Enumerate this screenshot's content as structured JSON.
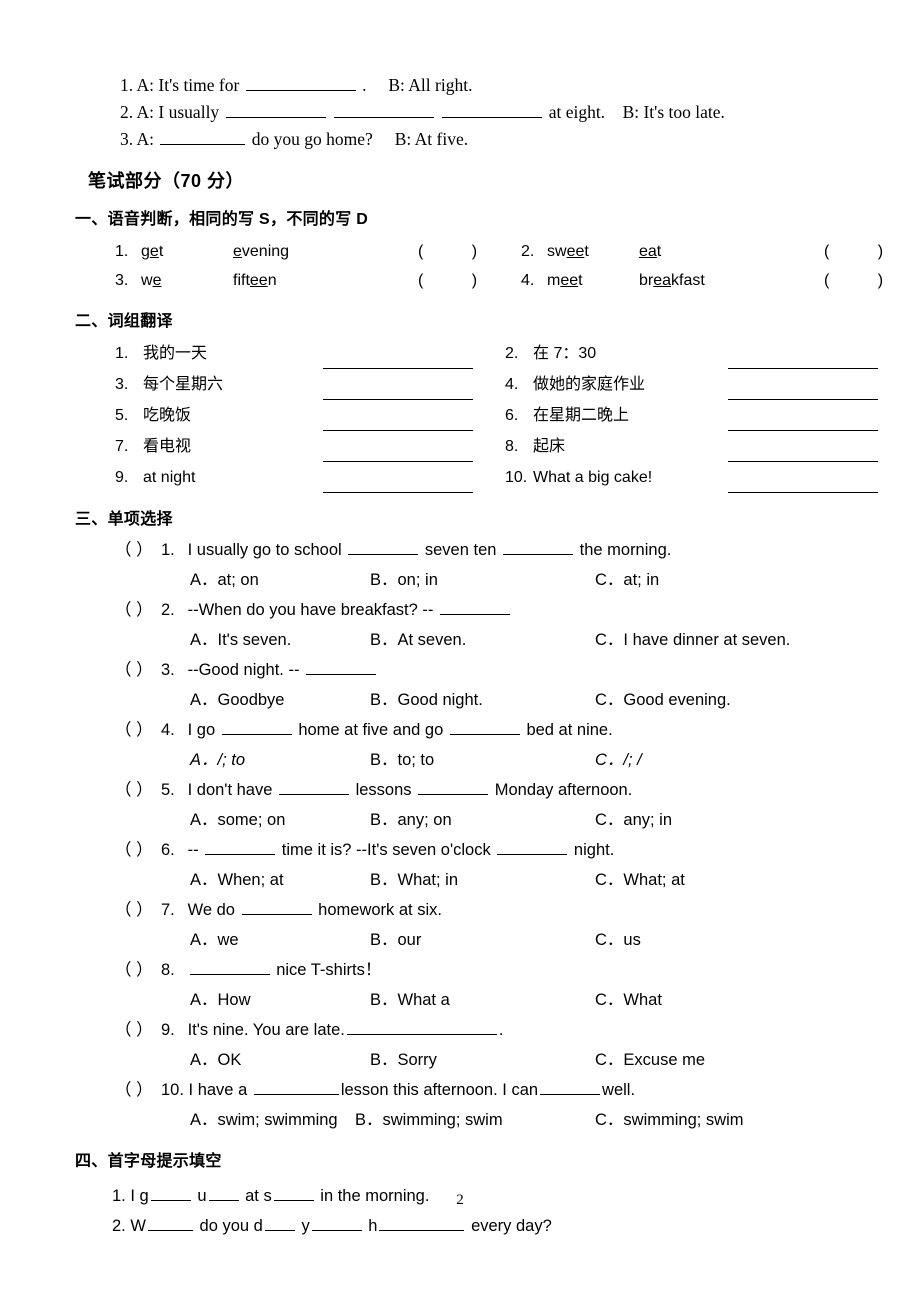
{
  "page": {
    "number": "2"
  },
  "listening_tail": {
    "items": [
      {
        "num": "1.",
        "speaker_a": "A: It's time for",
        "after_blank": ".",
        "speaker_b": "B: All right."
      },
      {
        "num": "2.",
        "speaker_a": "A: I usually",
        "after_blank": "at eight.",
        "speaker_b": "B: It's too late."
      },
      {
        "num": "3.",
        "speaker_a": "A:",
        "after_blank": "do you go home?",
        "speaker_b": "B: At five."
      }
    ]
  },
  "part_title": "笔试部分（70 分）",
  "section1": {
    "heading": "一、语音判断，相同的写 S，不同的写 D",
    "rows": [
      [
        {
          "num": "1.",
          "word1_pre": "g",
          "word1_ul": "e",
          "word1_post": "t",
          "word2_pre": "",
          "word2_ul": "e",
          "word2_post": "vening",
          "paren": "(      )"
        },
        {
          "num": "2.",
          "word1_pre": "sw",
          "word1_ul": "ee",
          "word1_post": "t",
          "word2_pre": "",
          "word2_ul": "ea",
          "word2_post": "t",
          "paren": "(      )"
        }
      ],
      [
        {
          "num": "3.",
          "word1_pre": "w",
          "word1_ul": "e",
          "word1_post": "",
          "word2_pre": "fift",
          "word2_ul": "ee",
          "word2_post": "n",
          "paren": "(      )"
        },
        {
          "num": "4.",
          "word1_pre": "m",
          "word1_ul": "ee",
          "word1_post": "t",
          "word2_pre": "br",
          "word2_ul": "ea",
          "word2_post": "kfast",
          "paren": "(      )"
        }
      ]
    ]
  },
  "section2": {
    "heading": "二、词组翻译",
    "rows": [
      [
        {
          "num": "1.",
          "text": "我的一天"
        },
        {
          "num": "2.",
          "text": "在 7：30"
        }
      ],
      [
        {
          "num": "3.",
          "text": "每个星期六"
        },
        {
          "num": "4.",
          "text": "做她的家庭作业"
        }
      ],
      [
        {
          "num": "5.",
          "text": "吃晚饭"
        },
        {
          "num": "6.",
          "text": "在星期二晚上"
        }
      ],
      [
        {
          "num": "7.",
          "text": "看电视"
        },
        {
          "num": "8.",
          "text": "起床"
        }
      ],
      [
        {
          "num": "9.",
          "text": "at night"
        },
        {
          "num": "10.",
          "text": "What a big cake!"
        }
      ]
    ]
  },
  "section3": {
    "heading": "三、单项选择",
    "questions": [
      {
        "paren": "（    ）",
        "num": "1.",
        "stem_parts": [
          "I usually go to school",
          "seven ten",
          "the morning."
        ],
        "options": [
          "A．at; on",
          "B．on; in",
          "C．at; in"
        ]
      },
      {
        "paren": "（    ）",
        "num": "2.",
        "stem_parts": [
          "--When do you have breakfast?   --",
          "",
          ""
        ],
        "options": [
          "A．It's seven.",
          "B．At seven.",
          "C．I have dinner at seven."
        ]
      },
      {
        "paren": "（    ）",
        "num": "3.",
        "stem_parts": [
          "--Good night.   --",
          "",
          ""
        ],
        "options": [
          "A．Goodbye",
          "B．Good night.",
          "C．Good evening."
        ]
      },
      {
        "paren": "（    ）",
        "num": "4.",
        "stem_parts": [
          "I go",
          "home at five and go",
          "bed at nine."
        ],
        "options": [
          "A．/; to",
          "B．to; to",
          "C．/; /"
        ]
      },
      {
        "paren": "（    ）",
        "num": "5.",
        "stem_parts": [
          "I don't have",
          "lessons",
          "Monday afternoon."
        ],
        "options": [
          "A．some; on",
          "B．any; on",
          "C．any; in"
        ]
      },
      {
        "paren": "（    ）",
        "num": "6.",
        "stem_parts": [
          "--",
          "time it is?   --It's seven o'clock",
          "night."
        ],
        "options": [
          "A．When; at",
          "B．What; in",
          "C．What; at"
        ]
      },
      {
        "paren": "（    ）",
        "num": "7.",
        "stem_parts": [
          "We do",
          "homework at six.",
          ""
        ],
        "options": [
          "A．we",
          "B．our",
          "C．us"
        ]
      },
      {
        "paren": "（    ）",
        "num": "8.",
        "stem_parts": [
          "",
          "nice T-shirts！",
          ""
        ],
        "options": [
          "A．How",
          "B．What a",
          "C．What"
        ]
      },
      {
        "paren": "（    ）",
        "num": "9.",
        "stem_parts": [
          "It's nine. You are late.",
          ".",
          ""
        ],
        "options": [
          "A．OK",
          "B．Sorry",
          "C．Excuse me"
        ]
      },
      {
        "paren": "（    ）",
        "num": "10.",
        "stem_parts": [
          "I have a",
          "lesson this afternoon. I can",
          "well."
        ],
        "options": [
          "A．swim; swimming",
          "B．swimming; swim",
          "C．swimming; swim"
        ]
      }
    ]
  },
  "section4": {
    "heading": "四、首字母提示填空",
    "items": [
      {
        "num": "1.",
        "segs": [
          "I g",
          "u",
          "at s",
          "in the morning."
        ]
      },
      {
        "num": "2.",
        "segs": [
          "W",
          "do you d",
          "y",
          "h",
          "every day?"
        ]
      }
    ]
  }
}
